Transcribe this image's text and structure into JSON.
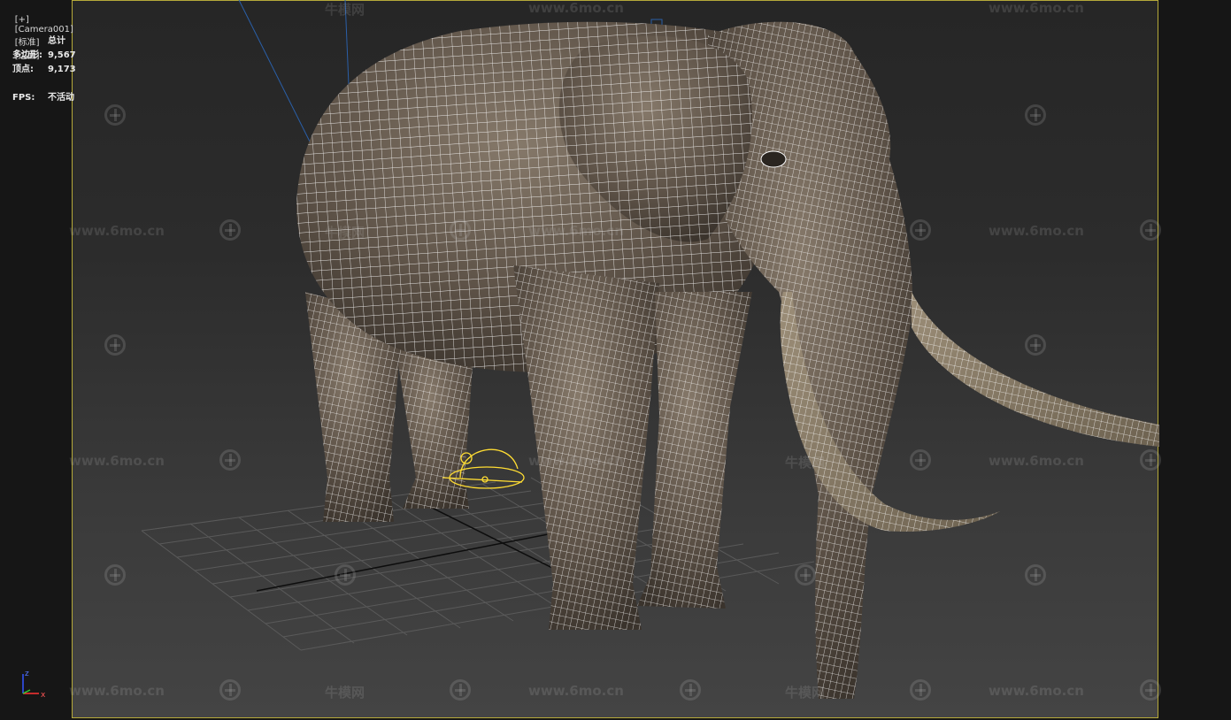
{
  "viewport": {
    "labels": [
      "[+]",
      "[Camera001]",
      "[标准]",
      "[边面]"
    ]
  },
  "stats": {
    "header": "总计",
    "polys_label": "多边形:",
    "polys_value": "9,567",
    "verts_label": "顶点:",
    "verts_value": "9,173",
    "fps_label": "FPS:",
    "fps_value": "不活动"
  },
  "axis": {
    "x": "x",
    "y": "y",
    "z": "z"
  },
  "watermarks": {
    "url": "www.6mo.cn",
    "brand": "牛模网"
  },
  "colors": {
    "frame_border": "#b5a93a",
    "wire": "#ffffff",
    "elephant_skin": "#6e6153",
    "tusk": "#8d7e68",
    "gizmo_yellow": "#ffdd33",
    "camera_line": "#2a5fa8"
  }
}
